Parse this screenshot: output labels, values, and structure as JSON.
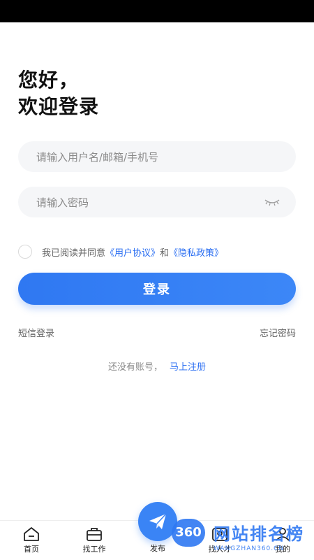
{
  "greeting": {
    "line1": "您好，",
    "line2": "欢迎登录"
  },
  "form": {
    "username_placeholder": "请输入用户名/邮箱/手机号",
    "password_placeholder": "请输入密码"
  },
  "agreement": {
    "prefix": "我已阅读并同意",
    "user_agreement": "《用户协议》",
    "and": "和",
    "privacy_policy": "《隐私政策》"
  },
  "login_button": "登录",
  "links": {
    "sms_login": "短信登录",
    "forgot_password": "忘记密码"
  },
  "register": {
    "prompt": "还没有账号，",
    "action": "马上注册"
  },
  "tabbar": {
    "home": "首页",
    "find_job": "找工作",
    "publish": "发布",
    "find_talent": "找人才",
    "mine": "我的"
  },
  "watermark": {
    "logo": "360",
    "title": "网站排名榜",
    "subtitle": "WANGZHAN360.CN"
  },
  "colors": {
    "accent": "#2f78f2",
    "input_bg": "#f5f6f8"
  }
}
